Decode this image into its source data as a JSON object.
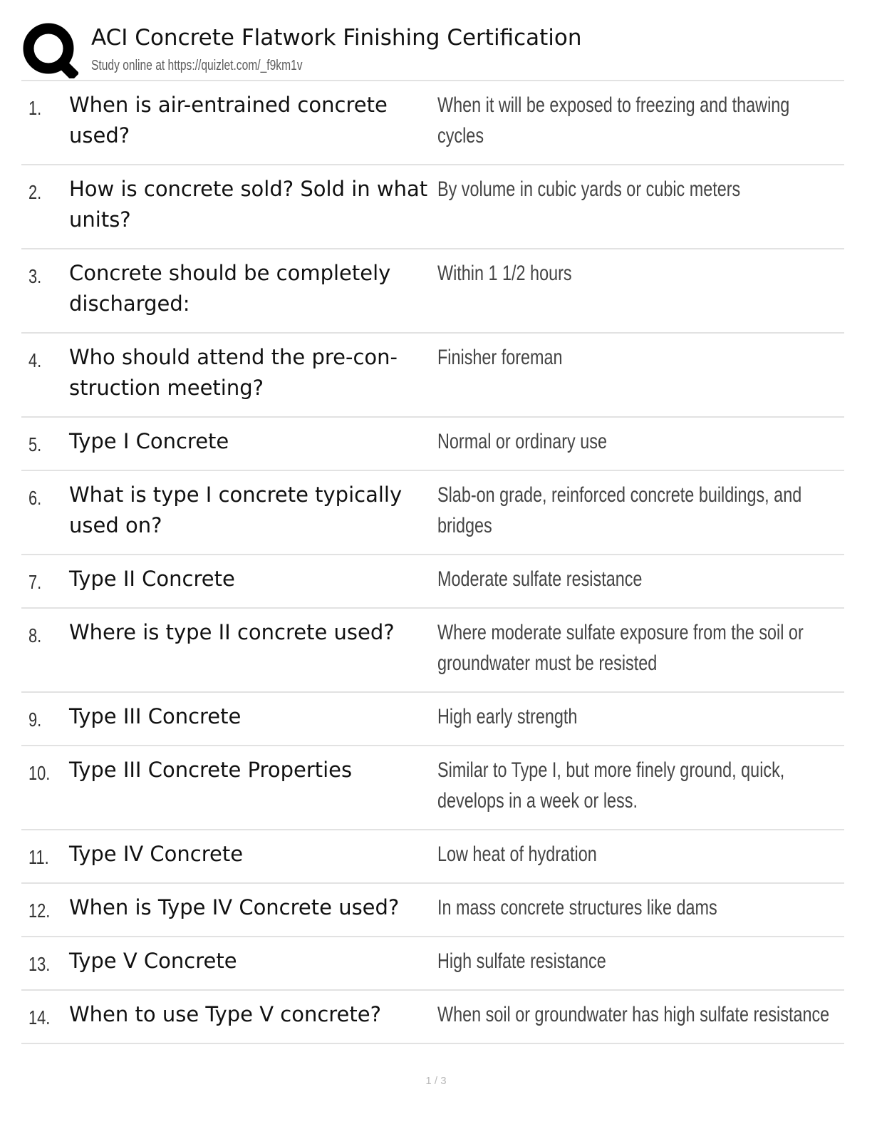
{
  "header": {
    "logo_icon": "quizlet-q-logo-icon",
    "title": "ACI Concrete Flatwork Finishing Certification",
    "study_online_text": "Study online at https://quizlet.com/_f9km1v"
  },
  "cards": [
    {
      "number": "1.",
      "term": "When is air-entrained concrete used?",
      "definition": "When it will be exposed to freezing and thawing cycles"
    },
    {
      "number": "2.",
      "term": "How is concrete sold? Sold in what units?",
      "definition": "By volume in cubic yards or cubic meters"
    },
    {
      "number": "3.",
      "term": "Concrete should be completely discharged:",
      "definition": "Within 1 1/2 hours"
    },
    {
      "number": "4.",
      "term": "Who should attend the pre-con- struction meeting?",
      "definition": "Finisher foreman"
    },
    {
      "number": "5.",
      "term": "Type I Concrete",
      "definition": "Normal or ordinary use"
    },
    {
      "number": "6.",
      "term": "What is type I concrete typically used on?",
      "definition": "Slab-on grade, reinforced concrete buildings, and bridges"
    },
    {
      "number": "7.",
      "term": "Type II Concrete",
      "definition": "Moderate sulfate resistance"
    },
    {
      "number": "8.",
      "term": "Where is type II concrete used?",
      "definition": "Where moderate sulfate exposure from the soil or groundwater must be resisted"
    },
    {
      "number": "9.",
      "term": "Type III Concrete",
      "definition": "High early strength"
    },
    {
      "number": "10.",
      "term": "Type III Concrete Properties",
      "definition": "Similar to Type I, but more finely ground, quick, develops in a week or less."
    },
    {
      "number": "11.",
      "term": "Type IV Concrete",
      "definition": "Low heat of hydration"
    },
    {
      "number": "12.",
      "term": "When is Type IV Concrete used?",
      "definition": "In mass concrete structures like dams"
    },
    {
      "number": "13.",
      "term": "Type V Concrete",
      "definition": "High sulfate resistance"
    },
    {
      "number": "14.",
      "term": "When to use Type V concrete?",
      "definition": "When soil or groundwater has high sulfate resistance"
    }
  ],
  "footer": {
    "page_number": "1 / 3"
  }
}
